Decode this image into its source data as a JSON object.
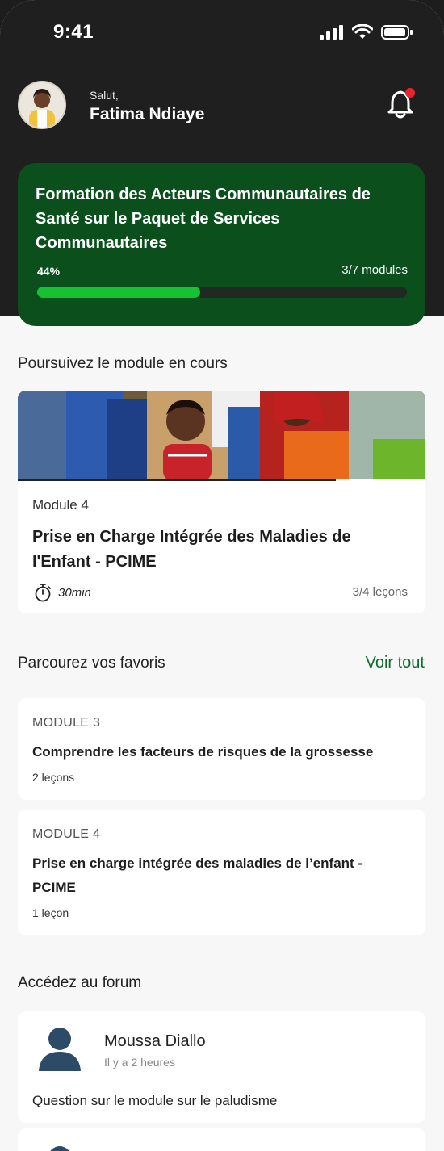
{
  "status_bar": {
    "time": "9:41"
  },
  "header": {
    "greeting": "Salut,",
    "user_name": "Fatima Ndiaye"
  },
  "current_course": {
    "title": "Formation des Acteurs Communautaires de Santé sur le Paquet de Services Communautaires",
    "progress_label": "44%",
    "progress": 0.44,
    "modules_label": "3/7 modules"
  },
  "continue_section": {
    "heading": "Poursuivez le module en cours",
    "module_label": "Module 4",
    "module_title": "Prise en Charge Intégrée des Maladies de l'Enfant - PCIME",
    "duration": "30min",
    "lessons": "3/4 leçons",
    "progress": 0.78
  },
  "favorites": {
    "heading": "Parcourez vos favoris",
    "see_all": "Voir tout",
    "items": [
      {
        "module": "MODULE 3",
        "title": "Comprendre les facteurs de risques de la grossesse",
        "lessons": "2 leçons"
      },
      {
        "module": "MODULE 4",
        "title": "Prise en charge intégrée des maladies de l’enfant - PCIME",
        "lessons": "1 leçon"
      }
    ]
  },
  "forum": {
    "heading": "Accédez au forum",
    "posts": [
      {
        "author": "Moussa Diallo",
        "time": "Il y a 2 heures",
        "question": "Question sur le module sur le paludisme"
      }
    ]
  },
  "colors": {
    "brand_green": "#0b4f1c",
    "progress_green": "#16c231",
    "link_green": "#0b6b2a",
    "notification_dot": "#e8242d"
  },
  "icons": [
    "signal-icon",
    "wifi-icon",
    "battery-icon",
    "bell-icon",
    "stopwatch-icon",
    "user-silhouette-icon"
  ]
}
